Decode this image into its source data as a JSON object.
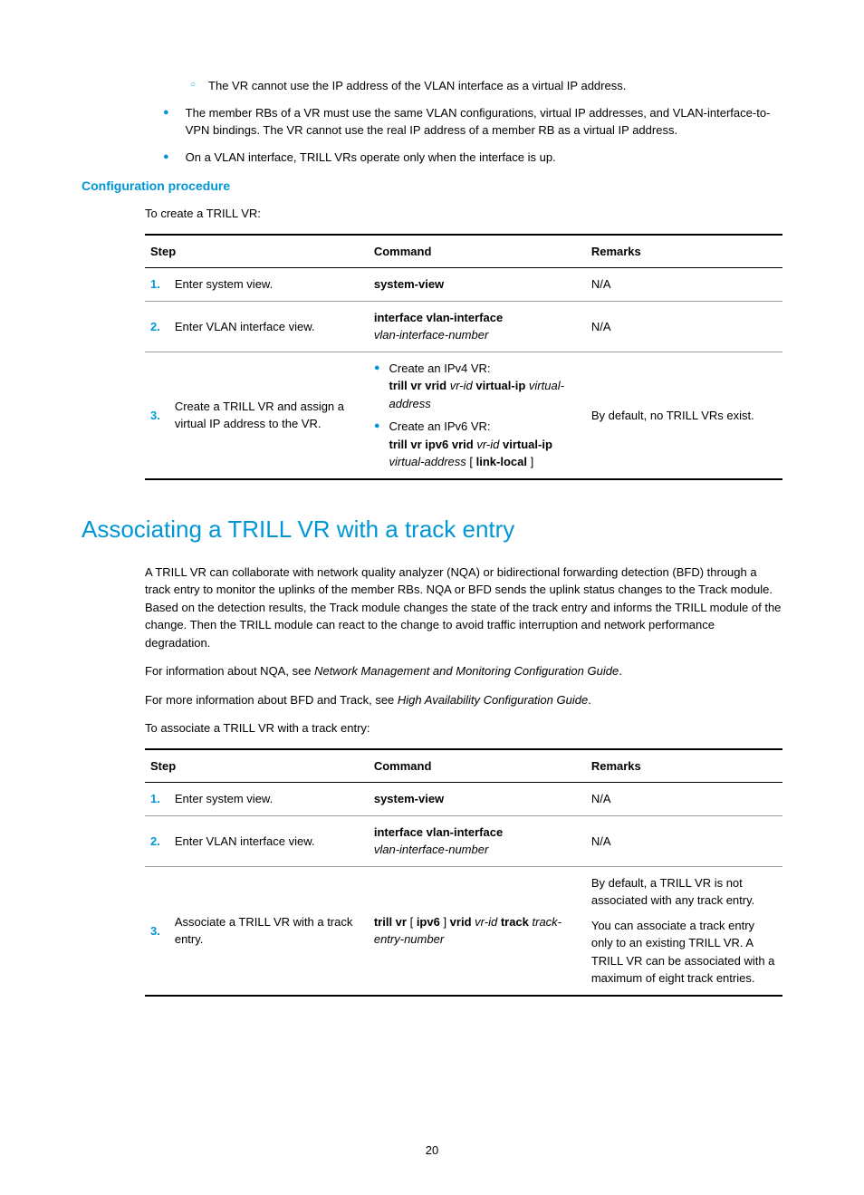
{
  "top_bullets": {
    "sub_item": "The VR cannot use the IP address of the VLAN interface as a virtual IP address.",
    "items": [
      "The member RBs of a VR must use the same VLAN configurations, virtual IP addresses, and VLAN-interface-to-VPN bindings. The VR cannot use the real IP address of a member RB as a virtual IP address.",
      "On a VLAN interface, TRILL VRs operate only when the interface is up."
    ]
  },
  "config_heading": "Configuration procedure",
  "intro1": "To create a TRILL VR:",
  "table1": {
    "headers": {
      "step": "Step",
      "command": "Command",
      "remarks": "Remarks"
    },
    "rows": [
      {
        "num": "1.",
        "step": "Enter system view.",
        "command_bold": "system-view",
        "remarks": "N/A"
      },
      {
        "num": "2.",
        "step": "Enter VLAN interface view.",
        "command_bold": "interface vlan-interface",
        "command_italic": "vlan-interface-number",
        "remarks": "N/A"
      },
      {
        "num": "3.",
        "step": "Create a TRILL VR and assign a virtual IP address to the VR.",
        "bullets": [
          {
            "intro": "Create an IPv4 VR:",
            "parts": [
              {
                "t": "trill vr vrid",
                "s": "bold"
              },
              {
                "t": " "
              },
              {
                "t": "vr-id",
                "s": "italic"
              },
              {
                "t": " "
              },
              {
                "t": "virtual-ip",
                "s": "bold"
              },
              {
                "t": " "
              },
              {
                "t": "virtual-address",
                "s": "italic"
              }
            ]
          },
          {
            "intro": "Create an IPv6 VR:",
            "parts": [
              {
                "t": "trill vr ipv6 vrid",
                "s": "bold"
              },
              {
                "t": " "
              },
              {
                "t": "vr-id",
                "s": "italic"
              },
              {
                "t": " "
              },
              {
                "t": "virtual-ip",
                "s": "bold"
              },
              {
                "t": " "
              },
              {
                "t": "virtual-address",
                "s": "italic"
              },
              {
                "t": " [ "
              },
              {
                "t": "link-local",
                "s": "bold"
              },
              {
                "t": " ]"
              }
            ]
          }
        ],
        "remarks": "By default, no TRILL VRs exist."
      }
    ]
  },
  "major_heading": "Associating a TRILL VR with a track entry",
  "paras": [
    "A TRILL VR can collaborate with network quality analyzer (NQA) or bidirectional forwarding detection (BFD) through a track entry to monitor the uplinks of the member RBs. NQA or BFD sends the uplink status changes to the Track module. Based on the detection results, the Track module changes the state of the track entry and informs the TRILL module of the change. Then the TRILL module can react to the change to avoid traffic interruption and network performance degradation."
  ],
  "para_nqa": {
    "pre": "For information about NQA, see ",
    "italic": "Network Management and Monitoring Configuration Guide",
    "post": "."
  },
  "para_bfd": {
    "pre": "For more information about BFD and Track, see ",
    "italic": "High Availability Configuration Guide",
    "post": "."
  },
  "intro2": "To associate a TRILL VR with a track entry:",
  "table2": {
    "headers": {
      "step": "Step",
      "command": "Command",
      "remarks": "Remarks"
    },
    "rows": [
      {
        "num": "1.",
        "step": "Enter system view.",
        "command_bold": "system-view",
        "remarks": "N/A"
      },
      {
        "num": "2.",
        "step": "Enter VLAN interface view.",
        "command_bold": "interface vlan-interface",
        "command_italic": "vlan-interface-number",
        "remarks": "N/A"
      },
      {
        "num": "3.",
        "step": "Associate a TRILL VR with a track entry.",
        "command_parts": [
          {
            "t": "trill vr",
            "s": "bold"
          },
          {
            "t": " [ "
          },
          {
            "t": "ipv6",
            "s": "bold"
          },
          {
            "t": " ] "
          },
          {
            "t": "vrid",
            "s": "bold"
          },
          {
            "t": " "
          },
          {
            "t": "vr-id",
            "s": "italic"
          },
          {
            "t": " "
          },
          {
            "t": "track",
            "s": "bold"
          },
          {
            "t": " "
          },
          {
            "t": "track-entry-number",
            "s": "italic"
          }
        ],
        "remarks_list": [
          "By default, a TRILL VR is not associated with any track entry.",
          "You can associate a track entry only to an existing TRILL VR. A TRILL VR can be associated with a maximum of eight track entries."
        ]
      }
    ]
  },
  "page_number": "20"
}
